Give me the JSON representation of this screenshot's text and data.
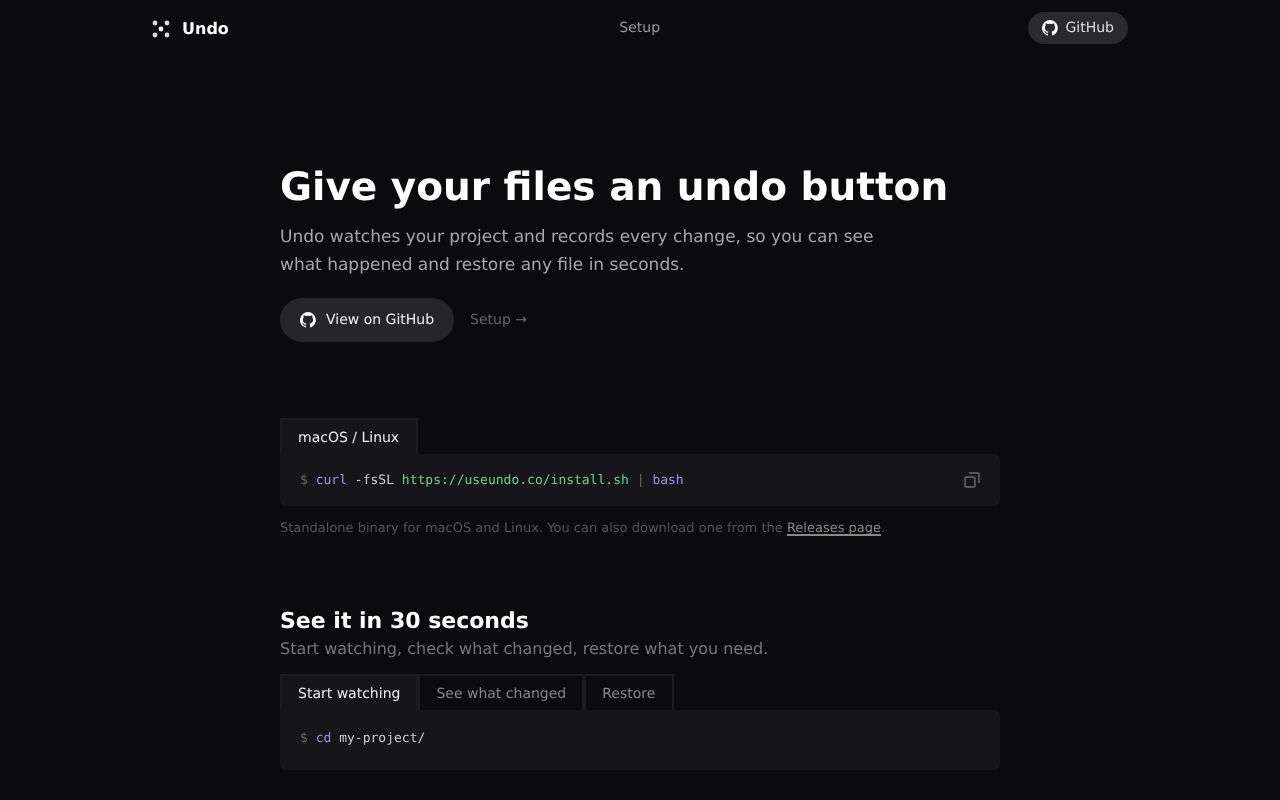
{
  "nav": {
    "brand": "Undo",
    "links": [
      "Setup"
    ],
    "github": "GitHub"
  },
  "hero": {
    "title": "Give your files an undo button",
    "lead": "Undo watches your project and records every change, so you can see what happened and restore any file in seconds.",
    "primary": "View on GitHub",
    "secondary": "Setup →"
  },
  "install": {
    "tabs": [
      {
        "label": "macOS / Linux",
        "selected": true
      }
    ],
    "command": [
      {
        "kind": "prompt",
        "text": "$"
      },
      {
        "kind": "cmd",
        "text": "curl"
      },
      {
        "kind": "arg",
        "text": "-fsSL"
      },
      {
        "kind": "url",
        "text": "https://useundo.co/install.sh"
      },
      {
        "kind": "prompt",
        "text": "|"
      },
      {
        "kind": "cmd",
        "text": "bash"
      }
    ],
    "note": "Standalone binary for macOS and Linux. You can also download one from the ",
    "note_link": "Releases page",
    "note_end": "."
  },
  "demo": {
    "title": "See it in 30 seconds",
    "subtitle": "Start watching, check what changed, restore what you need.",
    "tabs": [
      {
        "label": "Start watching",
        "selected": true
      },
      {
        "label": "See what changed",
        "selected": false
      },
      {
        "label": "Restore",
        "selected": false
      }
    ],
    "lines": [
      [
        {
          "kind": "prompt",
          "text": "$"
        },
        {
          "kind": "cmd",
          "text": "cd"
        },
        {
          "kind": "arg",
          "text": "my-project/"
        }
      ]
    ]
  }
}
